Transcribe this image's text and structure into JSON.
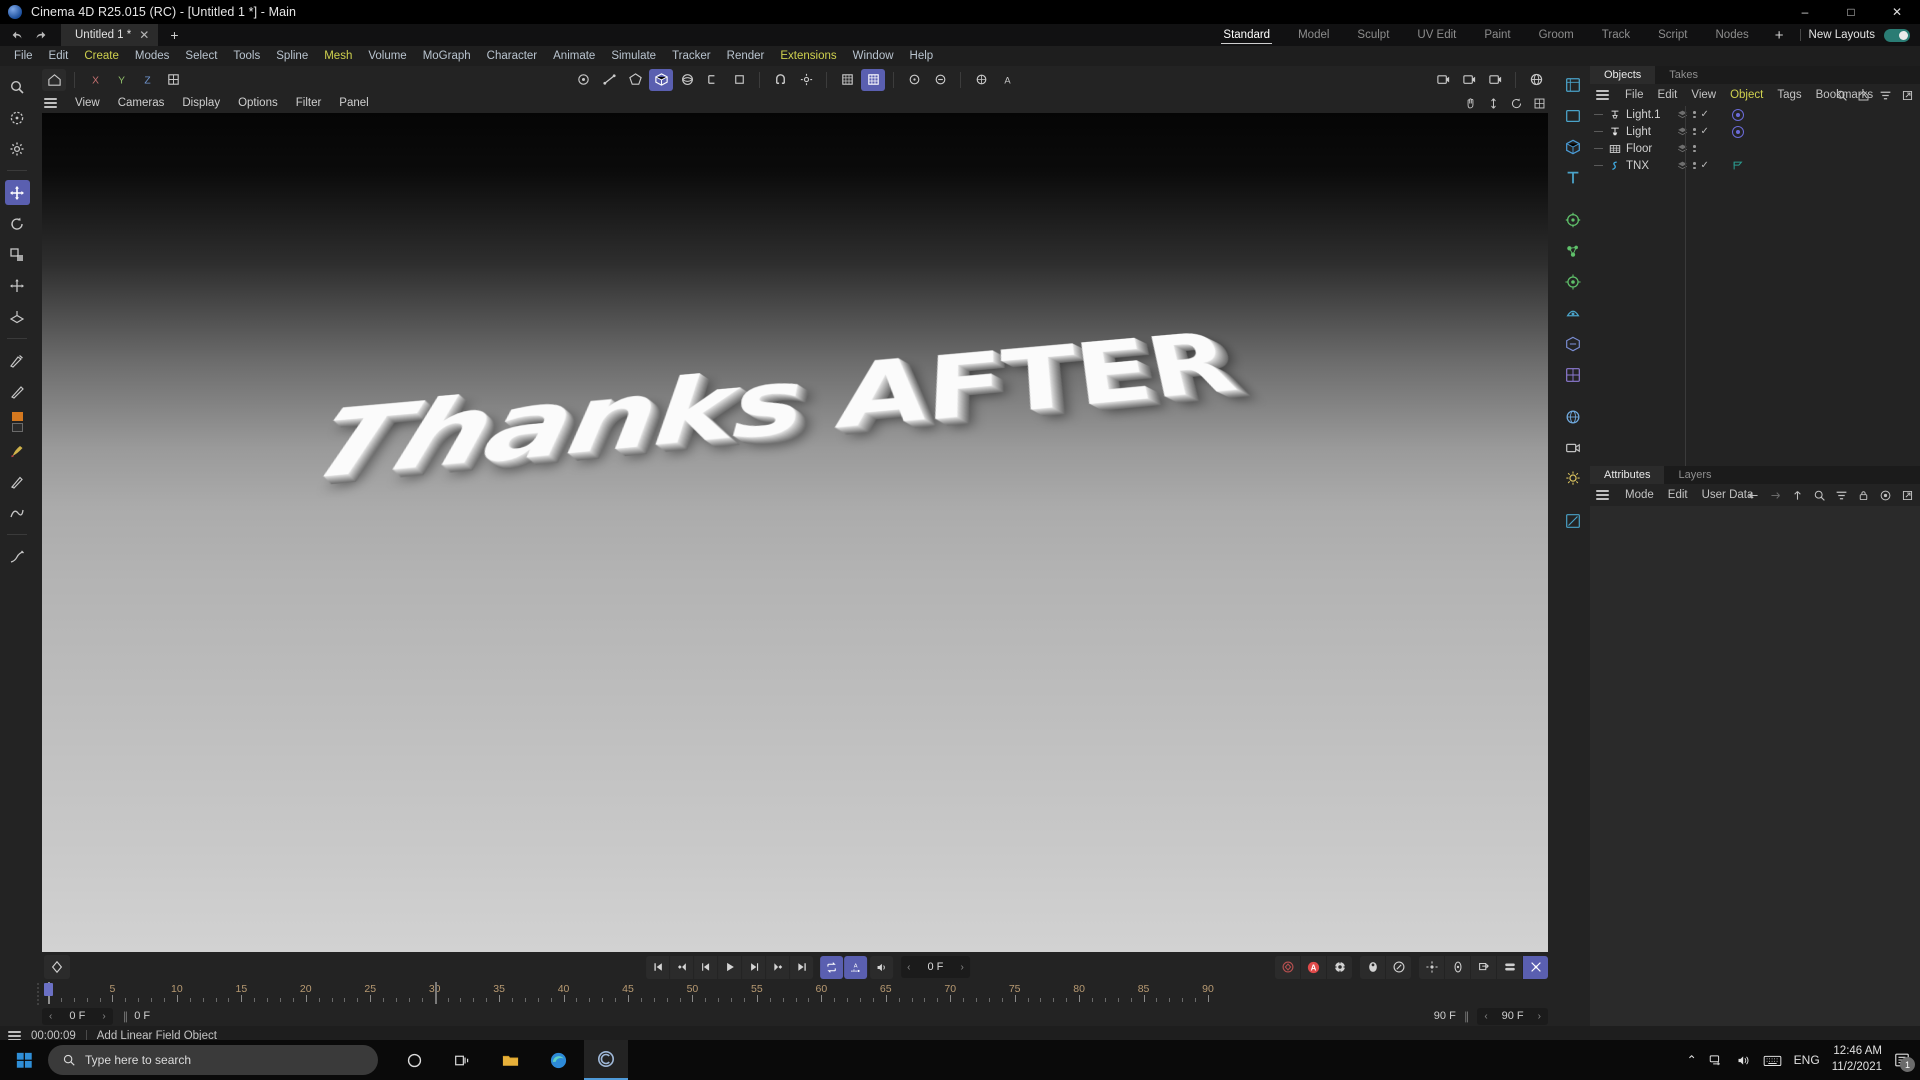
{
  "window": {
    "title": "Cinema 4D R25.015 (RC) - [Untitled 1 *] - Main",
    "minimize": "–",
    "maximize": "□",
    "close": "✕",
    "logo_icon": "cinema4d-logo-icon"
  },
  "tabstrip": {
    "undo_icon": "undo-icon",
    "redo_icon": "redo-icon",
    "document_tab": "Untitled 1 *",
    "tab_close": "✕",
    "new_tab": "+"
  },
  "layouts": {
    "tabs": [
      {
        "label": "Standard",
        "active": true
      },
      {
        "label": "Model",
        "active": false
      },
      {
        "label": "Sculpt",
        "active": false
      },
      {
        "label": "UV Edit",
        "active": false
      },
      {
        "label": "Paint",
        "active": false
      },
      {
        "label": "Groom",
        "active": false
      },
      {
        "label": "Track",
        "active": false
      },
      {
        "label": "Script",
        "active": false
      },
      {
        "label": "Nodes",
        "active": false
      }
    ],
    "add_layout": "+",
    "new_layouts_label": "New Layouts",
    "new_layouts_enabled": true,
    "toggle_color": "#2a7c74"
  },
  "menubar": {
    "items": [
      {
        "label": "File",
        "highlight": false
      },
      {
        "label": "Edit",
        "highlight": false
      },
      {
        "label": "Create",
        "highlight": true
      },
      {
        "label": "Modes",
        "highlight": false
      },
      {
        "label": "Select",
        "highlight": false
      },
      {
        "label": "Tools",
        "highlight": false
      },
      {
        "label": "Spline",
        "highlight": false
      },
      {
        "label": "Mesh",
        "highlight": true
      },
      {
        "label": "Volume",
        "highlight": false
      },
      {
        "label": "MoGraph",
        "highlight": false
      },
      {
        "label": "Character",
        "highlight": false
      },
      {
        "label": "Animate",
        "highlight": false
      },
      {
        "label": "Simulate",
        "highlight": false
      },
      {
        "label": "Tracker",
        "highlight": false
      },
      {
        "label": "Render",
        "highlight": false
      },
      {
        "label": "Extensions",
        "highlight": true
      },
      {
        "label": "Window",
        "highlight": false
      },
      {
        "label": "Help",
        "highlight": false
      }
    ]
  },
  "left_toolbar": {
    "items": [
      {
        "icon": "magnifier-icon",
        "active": false
      },
      {
        "icon": "live-selection-icon",
        "active": false
      },
      {
        "icon": "settings-gear-icon",
        "active": false
      },
      {
        "icon": "move-tool-icon",
        "active": true
      },
      {
        "icon": "rotate-tool-icon",
        "active": false
      },
      {
        "icon": "scale-tool-icon",
        "active": false
      },
      {
        "icon": "axis-move-icon",
        "active": false
      },
      {
        "icon": "workplane-icon",
        "active": false
      },
      {
        "icon": "knife-icon",
        "active": false
      },
      {
        "icon": "polygon-pen-icon",
        "active": false
      },
      {
        "icon": "color-swatch-icon",
        "active": false
      },
      {
        "icon": "paint-brush-icon",
        "active": false
      },
      {
        "icon": "brush-icon",
        "active": false
      },
      {
        "icon": "spline-pen-icon",
        "active": false
      },
      {
        "icon": "sculpt-icon",
        "active": false
      }
    ]
  },
  "viewport_toolbar": {
    "left_group": [
      {
        "icon": "home-axis-icon",
        "active": false
      },
      {
        "icon": "x-axis-icon",
        "label": "X",
        "active": false
      },
      {
        "icon": "y-axis-icon",
        "label": "Y",
        "active": false
      },
      {
        "icon": "z-axis-icon",
        "label": "Z",
        "active": false
      },
      {
        "icon": "world-object-icon",
        "active": false
      }
    ],
    "center_group": [
      {
        "icon": "point-mode-icon",
        "active": false
      },
      {
        "icon": "edge-mode-icon",
        "active": false
      },
      {
        "icon": "polygon-mode-icon",
        "active": false
      },
      {
        "icon": "model-mode-icon",
        "active": true
      },
      {
        "icon": "texture-mode-icon",
        "active": false
      },
      {
        "icon": "viewport-solo-icon",
        "active": false
      },
      {
        "icon": "enable-axis-icon",
        "active": false
      },
      {
        "icon": "snap-magnet-icon",
        "active": false
      },
      {
        "icon": "snap-settings-icon",
        "active": false
      },
      {
        "icon": "workplane-lock-icon",
        "active": false
      },
      {
        "icon": "grid-snap-icon",
        "active": true
      },
      {
        "icon": "quantize-icon",
        "active": false
      },
      {
        "icon": "lock-axis-icon",
        "active": false
      },
      {
        "icon": "render-view-icon",
        "active": false
      },
      {
        "icon": "render-settings-icon",
        "active": false
      }
    ],
    "right_group": [
      {
        "icon": "render-region-icon",
        "active": false
      },
      {
        "icon": "render-to-pv-icon",
        "active": false
      },
      {
        "icon": "render-settings-gear-icon",
        "active": false
      },
      {
        "icon": "content-browser-icon",
        "active": false
      }
    ]
  },
  "viewport": {
    "menu": [
      "View",
      "Cameras",
      "Display",
      "Options",
      "Filter",
      "Panel"
    ],
    "hamburger_icon": "hamburger-icon",
    "right_icons": [
      "pan-hand-icon",
      "zoom-axis-icon",
      "rotate-view-icon",
      "maximize-view-icon"
    ],
    "scene_text": "Thanks AFTER"
  },
  "timeline": {
    "key_icon": "record-keyframe-diamond-icon",
    "playback": [
      {
        "icon": "go-to-start-icon"
      },
      {
        "icon": "previous-key-icon"
      },
      {
        "icon": "previous-frame-icon"
      },
      {
        "icon": "play-forward-icon"
      },
      {
        "icon": "next-frame-icon"
      },
      {
        "icon": "next-key-icon"
      },
      {
        "icon": "go-to-end-icon"
      }
    ],
    "loop_icon": "loop-playback-icon",
    "loop_active": true,
    "autokey_icon": "autokey-icon",
    "autokey_label": "A",
    "autokey_active": true,
    "sound_icon": "sound-icon",
    "current_frame": "0 F",
    "record_group": [
      {
        "icon": "record-active-objects-icon",
        "active": false
      },
      {
        "icon": "autokeying-icon",
        "label": "A",
        "active": false,
        "color": "#e04a4a"
      },
      {
        "icon": "keyframe-selection-icon",
        "active": false
      }
    ],
    "record_group2": [
      {
        "icon": "position-key-icon",
        "active": false
      },
      {
        "icon": "scale-key-icon",
        "active": false
      }
    ],
    "record_group3": [
      {
        "icon": "position-icon",
        "active": false
      },
      {
        "icon": "rotation-icon",
        "active": false
      },
      {
        "icon": "scale-param-icon",
        "active": false
      },
      {
        "icon": "pla-icon",
        "active": false
      },
      {
        "icon": "point-level-animation-icon",
        "active": true
      }
    ],
    "timeline_toggle_icon": "timeline-curves-icon",
    "ruler": {
      "min": 0,
      "max": 90,
      "step": 5,
      "labels": [
        0,
        5,
        10,
        15,
        20,
        25,
        30,
        35,
        40,
        45,
        50,
        55,
        60,
        65,
        70,
        75,
        80,
        85,
        90
      ],
      "playhead_frame": 0
    },
    "timebar": {
      "left_value": "0 F",
      "doc_value": "0 F",
      "right_value": "90 F",
      "right_value2": "90 F",
      "prev_arrow": "‹",
      "next_arrow": "›"
    }
  },
  "right_dock": {
    "items": [
      {
        "icon": "cube-primitive-icon"
      },
      {
        "icon": "plane-primitive-icon"
      },
      {
        "icon": "generator-icon"
      },
      {
        "icon": "text-spline-icon"
      },
      {
        "icon": "deformer-icon"
      },
      {
        "icon": "mograph-icon"
      },
      {
        "icon": "effector-icon"
      },
      {
        "icon": "simulation-icon"
      },
      {
        "icon": "volume-icon"
      },
      {
        "icon": "field-icon"
      },
      {
        "icon": "environment-icon"
      },
      {
        "icon": "camera-icon"
      },
      {
        "icon": "light-icon"
      },
      {
        "icon": "material-icon"
      }
    ]
  },
  "objects_panel": {
    "tabs": [
      {
        "label": "Objects",
        "active": true
      },
      {
        "label": "Takes",
        "active": false
      }
    ],
    "menu": [
      {
        "label": "File",
        "highlight": false
      },
      {
        "label": "Edit",
        "highlight": false
      },
      {
        "label": "View",
        "highlight": false
      },
      {
        "label": "Object",
        "highlight": true
      },
      {
        "label": "Tags",
        "highlight": false
      },
      {
        "label": "Bookmarks",
        "highlight": false
      }
    ],
    "menu_icons": [
      "search-icon",
      "home-icon",
      "filter-icon",
      "open-external-icon"
    ],
    "rows": [
      {
        "name": "Light.1",
        "icon": "light-object-icon",
        "has_check": true,
        "tag": "light-tag"
      },
      {
        "name": "Light",
        "icon": "light-object-icon",
        "has_check": true,
        "tag": "light-tag"
      },
      {
        "name": "Floor",
        "icon": "floor-object-icon",
        "has_check": false,
        "tag": "none"
      },
      {
        "name": "TNX",
        "icon": "spline-object-icon",
        "has_check": true,
        "tag": "flag-tag"
      }
    ]
  },
  "attributes_panel": {
    "tabs": [
      {
        "label": "Attributes",
        "active": true
      },
      {
        "label": "Layers",
        "active": false
      }
    ],
    "menu": [
      "Mode",
      "Edit",
      "User Data"
    ],
    "menu_icons": [
      "back-arrow-icon",
      "forward-arrow-icon",
      "up-arrow-icon",
      "search-icon",
      "filter-icon",
      "lock-icon",
      "record-icon",
      "open-external-icon"
    ]
  },
  "statusbar": {
    "hamburger_icon": "hamburger-icon",
    "time": "00:00:09",
    "message": "Add Linear Field Object"
  },
  "taskbar": {
    "start_icon": "windows-start-icon",
    "search_placeholder": "Type here to search",
    "search_icon": "search-icon",
    "items": [
      {
        "icon": "cortana-icon"
      },
      {
        "icon": "task-view-icon"
      },
      {
        "icon": "file-explorer-icon"
      },
      {
        "icon": "edge-browser-icon"
      },
      {
        "icon": "cinema4d-taskbar-icon",
        "active": true
      }
    ],
    "tray": {
      "chevron": "⌃",
      "icons": [
        "network-icon",
        "volume-icon",
        "keyboard-icon"
      ],
      "language": "ENG",
      "time": "12:46 AM",
      "date": "11/2/2021",
      "notification_count": "1"
    }
  }
}
